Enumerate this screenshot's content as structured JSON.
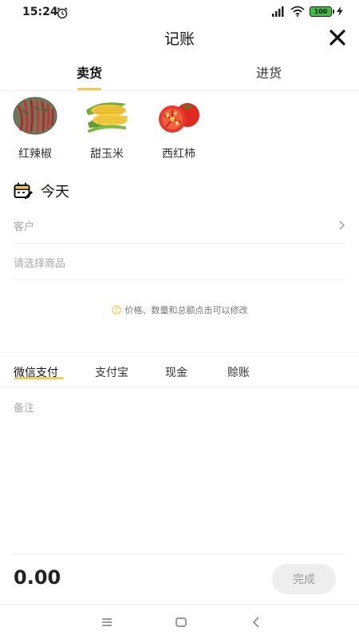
{
  "status_bar": {
    "time": "15:24",
    "battery": "100"
  },
  "header": {
    "title": "记账"
  },
  "tabs": [
    {
      "label": "卖货"
    },
    {
      "label": "进货"
    }
  ],
  "products": [
    {
      "name": "红辣椒",
      "icon": "red-chili-image"
    },
    {
      "name": "甜玉米",
      "icon": "sweet-corn-image"
    },
    {
      "name": "西红柿",
      "icon": "tomato-image"
    }
  ],
  "date": {
    "label": "今天"
  },
  "form": {
    "customer_placeholder": "客户",
    "goods_placeholder": "请选择商品",
    "hint": "价格、数量和总额点击可以修改"
  },
  "payments": [
    {
      "label": "微信支付"
    },
    {
      "label": "支付宝"
    },
    {
      "label": "现金"
    },
    {
      "label": "赊账"
    }
  ],
  "note": {
    "placeholder": "备注"
  },
  "footer": {
    "total": "0.00",
    "done_label": "完成"
  },
  "colors": {
    "accent": "#f2c94c",
    "button_bg": "#eeeeee",
    "battery": "#3fc23f"
  }
}
